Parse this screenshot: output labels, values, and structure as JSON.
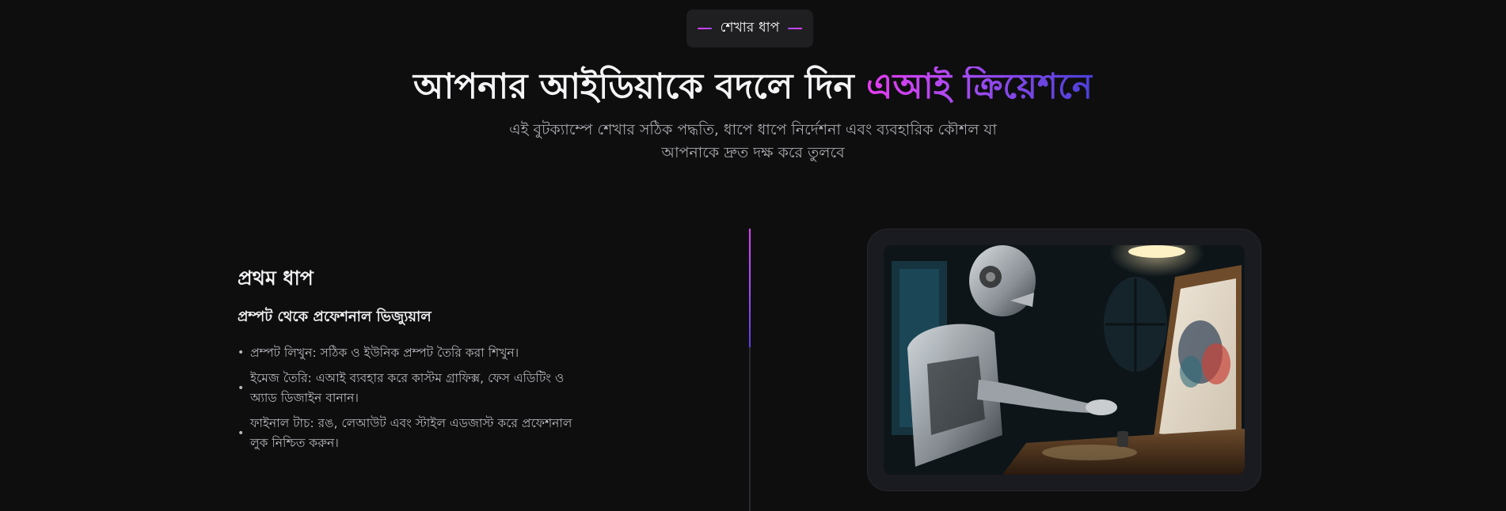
{
  "badge": {
    "label": "শেখার ধাপ"
  },
  "hero": {
    "title_main": "আপনার আইডিয়াকে বদলে দিন ",
    "title_accent": "এআই ক্রিয়েশনে",
    "subtitle": "এই বুটক্যাম্পে শেখার সঠিক পদ্ধতি, ধাপে ধাপে নির্দেশনা এবং ব্যবহারিক কৌশল যা আপনাকে দ্রুত দক্ষ করে তুলবে"
  },
  "step": {
    "heading": "প্রথম ধাপ",
    "subheading": "প্রম্পট থেকে প্রফেশনাল ভিজ্যুয়াল",
    "items": [
      "প্রম্পট লিখুন: সঠিক ও ইউনিক প্রম্পট তৈরি করা শিখুন।",
      "ইমেজ তৈরি: এআই ব্যবহার করে কাস্টম গ্রাফিক্স, ফেস এডিটিং ও অ্যাড ডিজাইন বানান।",
      "ফাইনাল টাচ: রঙ, লেআউট এবং স্টাইল এডজাস্ট করে প্রফেশনাল লুক নিশ্চিত করুন।"
    ]
  },
  "colors": {
    "background": "#0e0e0f",
    "accent_pink": "#e63cf0",
    "accent_purple": "#a24bf0",
    "accent_indigo": "#4a3fd8"
  },
  "icons": {
    "bullet": "dot-icon"
  }
}
